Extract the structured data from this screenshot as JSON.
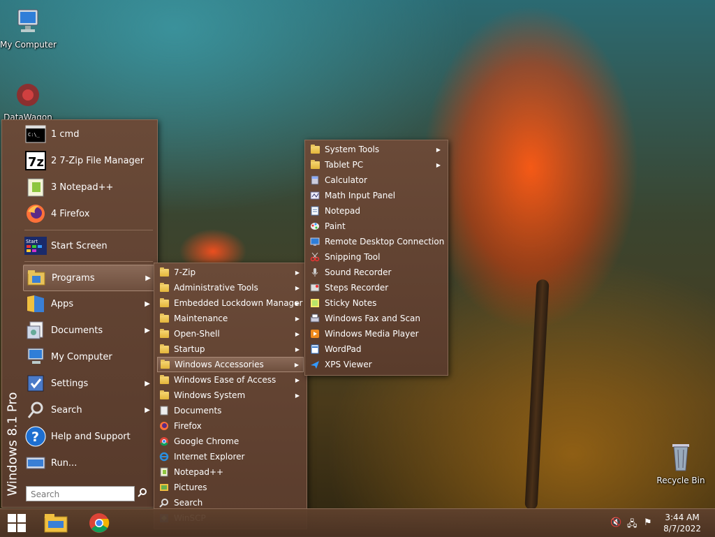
{
  "desktop": {
    "icons": [
      {
        "label": "My Computer",
        "icon": "computer-icon"
      },
      {
        "label": "DataWagon",
        "icon": "app-icon"
      },
      {
        "label": "Recycle Bin",
        "icon": "recycle-bin-icon"
      }
    ]
  },
  "start_menu": {
    "side_label": "Windows 8.1 Pro",
    "recent": [
      {
        "label": "1 cmd",
        "icon": "cmd-icon"
      },
      {
        "label": "2 7-Zip File Manager",
        "icon": "7zip-icon"
      },
      {
        "label": "3 Notepad++",
        "icon": "notepadpp-icon"
      },
      {
        "label": "4 Firefox",
        "icon": "firefox-icon"
      }
    ],
    "start_screen": {
      "label": "Start Screen",
      "icon": "start-screen-icon"
    },
    "main": [
      {
        "label": "Programs",
        "icon": "programs-folder-icon",
        "submenu": true
      },
      {
        "label": "Apps",
        "icon": "apps-folder-icon",
        "submenu": true
      },
      {
        "label": "Documents",
        "icon": "documents-icon",
        "submenu": true
      },
      {
        "label": "My Computer",
        "icon": "computer-icon",
        "submenu": false
      },
      {
        "label": "Settings",
        "icon": "settings-icon",
        "submenu": true
      },
      {
        "label": "Search",
        "icon": "search-icon",
        "submenu": true
      },
      {
        "label": "Help and Support",
        "icon": "help-icon",
        "submenu": false
      },
      {
        "label": "Run...",
        "icon": "run-icon",
        "submenu": false
      }
    ],
    "search_placeholder": "Search"
  },
  "programs_menu": {
    "items": [
      {
        "label": "7-Zip",
        "type": "folder",
        "submenu": true
      },
      {
        "label": "Administrative Tools",
        "type": "folder",
        "submenu": true
      },
      {
        "label": "Embedded Lockdown Manager",
        "type": "folder",
        "submenu": true
      },
      {
        "label": "Maintenance",
        "type": "folder",
        "submenu": true
      },
      {
        "label": "Open-Shell",
        "type": "folder",
        "submenu": true
      },
      {
        "label": "Startup",
        "type": "folder",
        "submenu": true
      },
      {
        "label": "Windows Accessories",
        "type": "folder",
        "submenu": true
      },
      {
        "label": "Windows Ease of Access",
        "type": "folder",
        "submenu": true
      },
      {
        "label": "Windows System",
        "type": "folder",
        "submenu": true
      },
      {
        "label": "Documents",
        "type": "documents-icon",
        "submenu": false
      },
      {
        "label": "Firefox",
        "type": "firefox-icon",
        "submenu": false
      },
      {
        "label": "Google Chrome",
        "type": "chrome-icon",
        "submenu": false
      },
      {
        "label": "Internet Explorer",
        "type": "ie-icon",
        "submenu": false
      },
      {
        "label": "Notepad++",
        "type": "notepadpp-icon",
        "submenu": false
      },
      {
        "label": "Pictures",
        "type": "pictures-icon",
        "submenu": false
      },
      {
        "label": "Search",
        "type": "search-icon",
        "submenu": false
      },
      {
        "label": "WinSCP",
        "type": "winscp-icon",
        "submenu": false
      }
    ]
  },
  "accessories_menu": {
    "items": [
      {
        "label": "System Tools",
        "type": "folder",
        "submenu": true
      },
      {
        "label": "Tablet PC",
        "type": "folder",
        "submenu": true
      },
      {
        "label": "Calculator",
        "type": "calculator-icon",
        "submenu": false
      },
      {
        "label": "Math Input Panel",
        "type": "math-input-icon",
        "submenu": false
      },
      {
        "label": "Notepad",
        "type": "notepad-icon",
        "submenu": false
      },
      {
        "label": "Paint",
        "type": "paint-icon",
        "submenu": false
      },
      {
        "label": "Remote Desktop Connection",
        "type": "remote-desktop-icon",
        "submenu": false
      },
      {
        "label": "Snipping Tool",
        "type": "snipping-tool-icon",
        "submenu": false
      },
      {
        "label": "Sound Recorder",
        "type": "sound-recorder-icon",
        "submenu": false
      },
      {
        "label": "Steps Recorder",
        "type": "steps-recorder-icon",
        "submenu": false
      },
      {
        "label": "Sticky Notes",
        "type": "sticky-notes-icon",
        "submenu": false
      },
      {
        "label": "Windows Fax and Scan",
        "type": "fax-scan-icon",
        "submenu": false
      },
      {
        "label": "Windows Media Player",
        "type": "media-player-icon",
        "submenu": false
      },
      {
        "label": "WordPad",
        "type": "wordpad-icon",
        "submenu": false
      },
      {
        "label": "XPS Viewer",
        "type": "xps-viewer-icon",
        "submenu": false
      }
    ]
  },
  "taskbar": {
    "pinned": [
      {
        "icon": "start-icon"
      },
      {
        "icon": "file-explorer-icon"
      },
      {
        "icon": "chrome-icon"
      }
    ],
    "tray": [
      {
        "icon": "volume-muted-icon"
      },
      {
        "icon": "network-icon"
      },
      {
        "icon": "action-center-icon"
      }
    ],
    "time": "3:44 AM",
    "date": "8/7/2022"
  }
}
